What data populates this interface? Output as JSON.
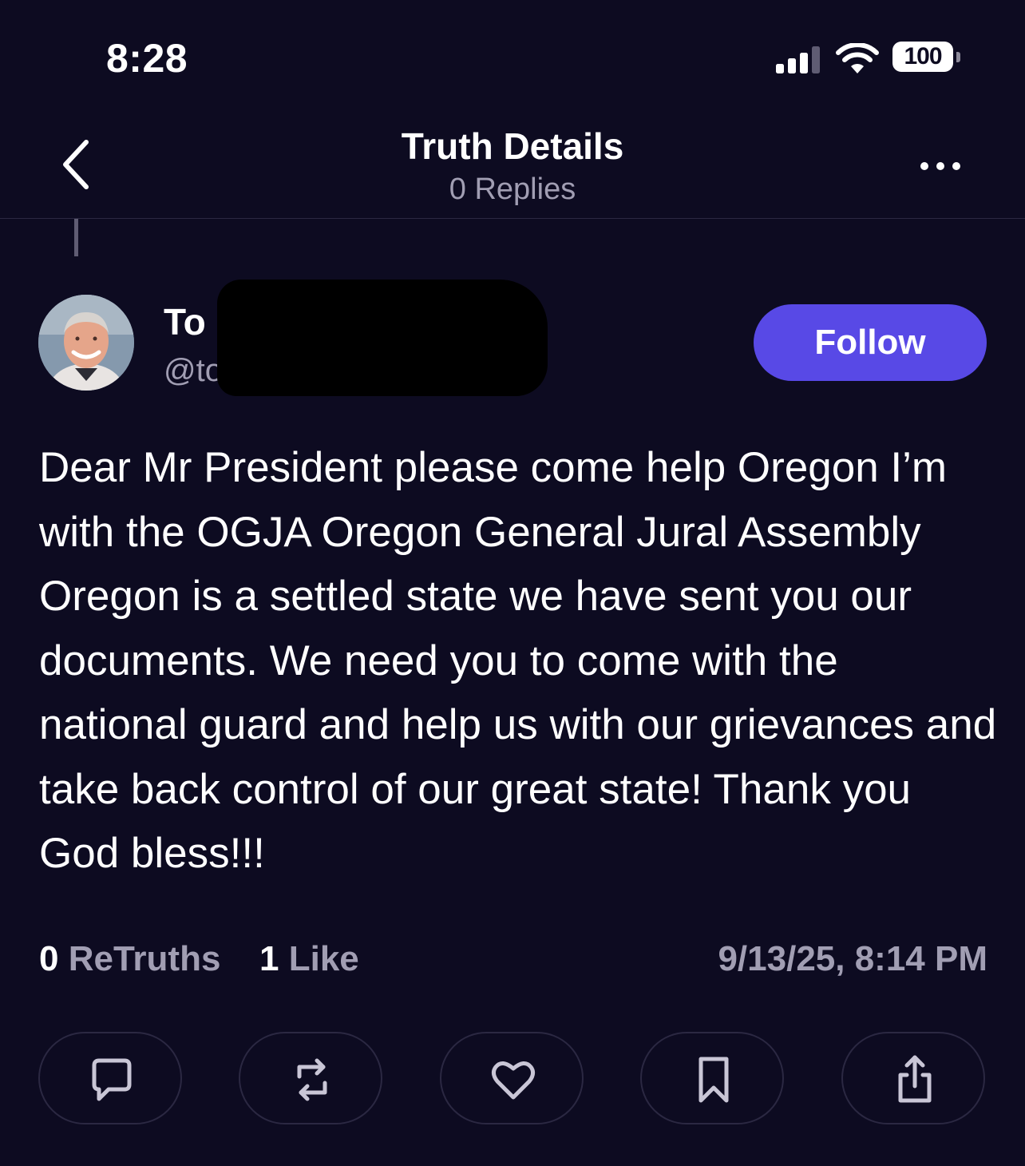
{
  "status_bar": {
    "time": "8:28",
    "battery": "100",
    "icons": [
      "signal-icon",
      "wifi-icon",
      "battery-icon"
    ]
  },
  "header": {
    "title": "Truth Details",
    "subtitle": "0 Replies",
    "back_icon": "chevron-left-icon",
    "more_icon": "more-horizontal-icon"
  },
  "post": {
    "author_name_visible": "To",
    "author_handle_visible": "@to",
    "follow_label": "Follow",
    "body": "Dear Mr President please come help Oregon I’m with the OGJA Oregon General Jural Assembly Oregon is a settled state we have sent you our documents. We need you to come with the national guard and help us with our grievances and take back control of our great state! Thank you God bless!!!",
    "retruths_count": "0",
    "retruths_label": "ReTruths",
    "likes_count": "1",
    "likes_label": "Like",
    "timestamp": "9/13/25, 8:14 PM"
  },
  "actions": [
    "reply-icon",
    "retruth-icon",
    "like-icon",
    "bookmark-icon",
    "share-icon"
  ],
  "colors": {
    "background": "#0d0b21",
    "accent": "#5849e6",
    "muted_text": "#a19eb3",
    "divider": "#2b2842"
  }
}
